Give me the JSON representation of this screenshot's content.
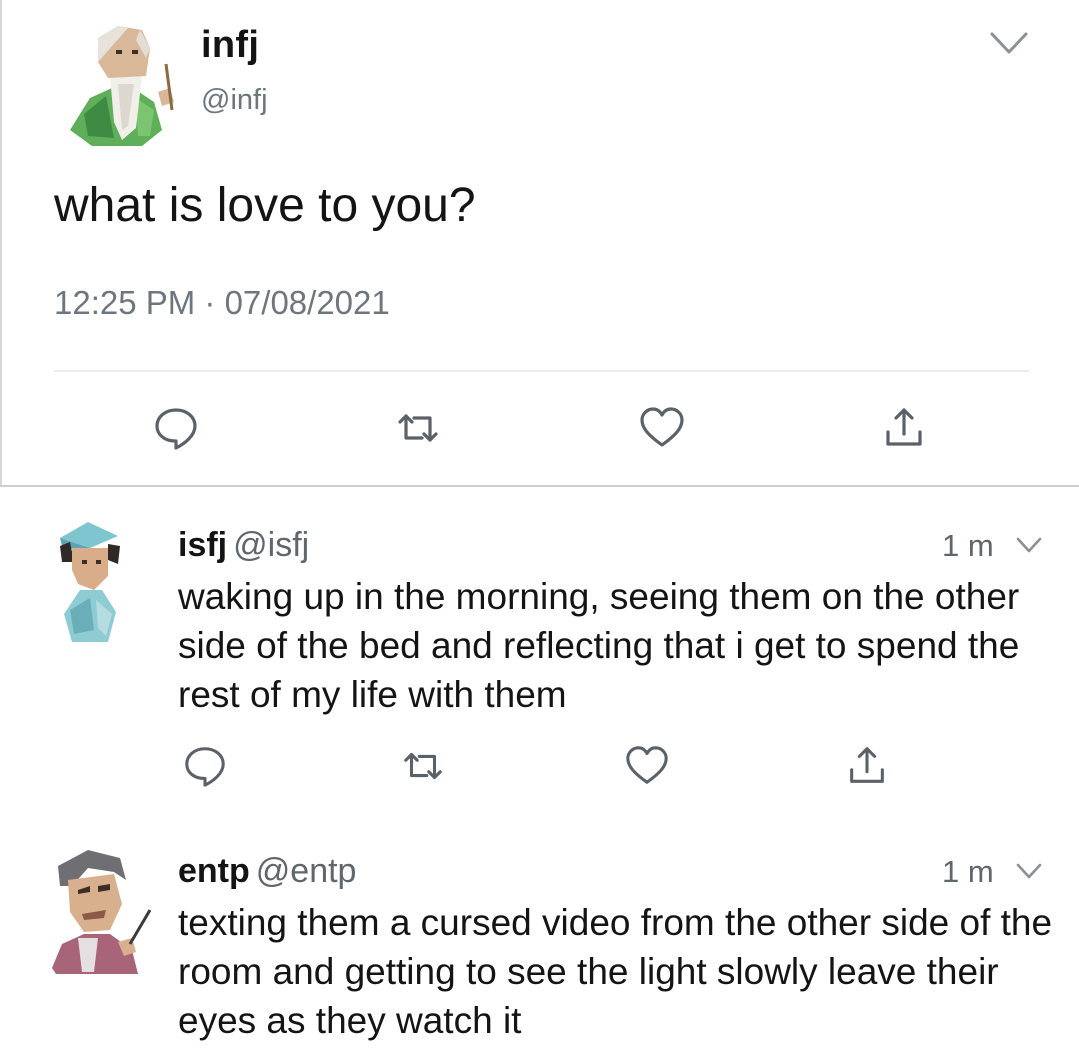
{
  "main_tweet": {
    "display_name": "infj",
    "handle": "@infj",
    "text": "what is love to you?",
    "timestamp": "12:25 PM · 07/08/2021",
    "avatar_icon": "old-sage-avatar",
    "actions": [
      "reply-icon",
      "retweet-icon",
      "like-icon",
      "share-icon"
    ]
  },
  "replies": [
    {
      "display_name": "isfj",
      "handle": "@isfj",
      "time": "1 m",
      "text": "waking up in the morning, seeing them on the other side of the bed and reflecting that i get to spend the rest of my life with them",
      "avatar_icon": "nurse-avatar"
    },
    {
      "display_name": "entp",
      "handle": "@entp",
      "time": "1 m",
      "text": "texting them a cursed video from the other side of the room and getting to see the light slowly leave their eyes as they watch it",
      "avatar_icon": "mischievous-avatar"
    }
  ],
  "colors": {
    "text": "#141414",
    "secondary": "#6e767d",
    "divider": "#cfcfcf"
  }
}
